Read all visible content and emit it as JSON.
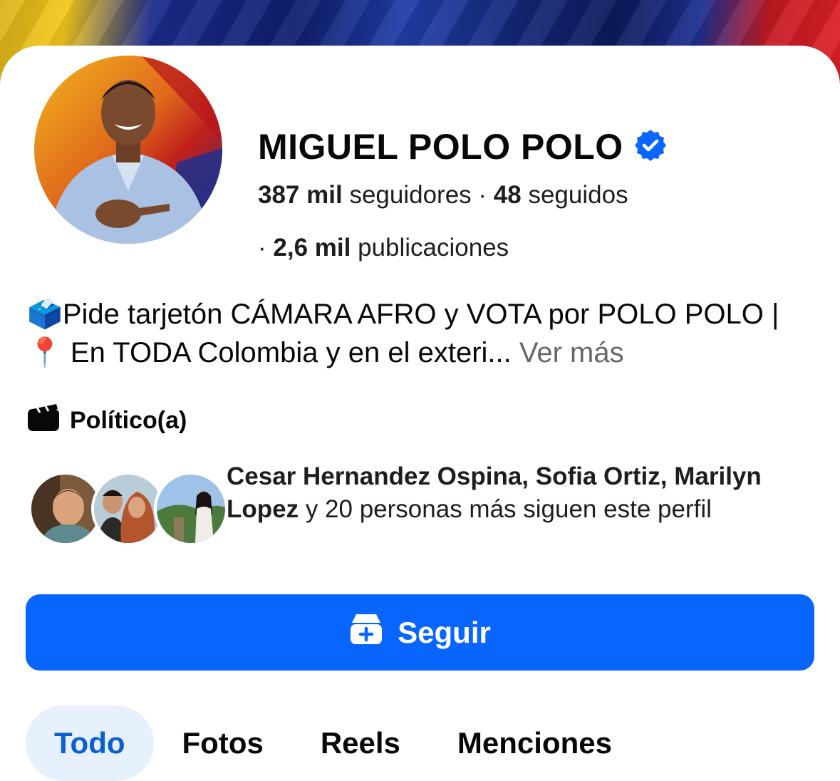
{
  "profile": {
    "name": "MIGUEL POLO POLO",
    "verified_icon": "verified-badge-icon",
    "followers_count": "387 mil",
    "followers_label": "seguidores",
    "separator": "·",
    "following_count": "48",
    "following_label": "seguidos",
    "posts_count": "2,6 mil",
    "posts_label": "publicaciones"
  },
  "bio": {
    "ballot_emoji": "🗳️",
    "text_1": "Pide tarjetón CÁMARA AFRO y VOTA por POLO POLO | ",
    "pin_emoji": "📍",
    "text_2": " En TODA Colombia y en el exteri...",
    "more_label": "Ver más"
  },
  "category": {
    "icon": "clapperboard-icon",
    "label": "Político(a)"
  },
  "mutual_followers": {
    "names": "Cesar Hernandez Ospina, Sofia Ortiz, Marilyn Lopez",
    "connector": " y 20 personas más siguen este perfil"
  },
  "actions": {
    "follow_label": "Seguir",
    "follow_icon": "follow-box-plus-icon",
    "button_color": "#0866ff"
  },
  "tabs": [
    {
      "label": "Todo",
      "active": true
    },
    {
      "label": "Fotos",
      "active": false
    },
    {
      "label": "Reels",
      "active": false
    },
    {
      "label": "Menciones",
      "active": false
    }
  ],
  "colors": {
    "accent": "#0866ff",
    "active_tab_bg": "#e7f0fd",
    "active_tab_text": "#0b5fd0",
    "muted": "#65676b",
    "verified": "#0866ff"
  }
}
